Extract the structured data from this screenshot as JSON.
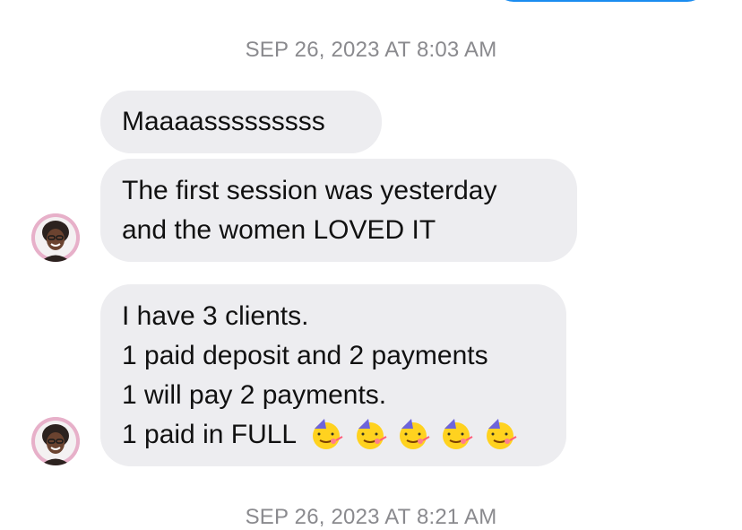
{
  "conversation": {
    "timestamps": [
      "SEP 26, 2023 AT 8:03 AM",
      "SEP 26, 2023 AT 8:21 AM"
    ],
    "messages": [
      {
        "lines": [
          "Maaaasssssssss"
        ]
      },
      {
        "lines": [
          "The first session was yesterday",
          "and the women LOVED IT"
        ]
      },
      {
        "lines": [
          "I have 3 clients.",
          "1 paid deposit and 2 payments",
          "1 will pay 2 payments.",
          "1 paid in FULL"
        ]
      }
    ],
    "emoji_icon": "partying-face-icon",
    "emoji_count": 5
  },
  "colors": {
    "incoming_bubble": "#ededf0",
    "timestamp_text": "#8a8a8e",
    "outgoing_bubble": "#1a8cf0",
    "avatar_border": "#e7b0c9"
  }
}
